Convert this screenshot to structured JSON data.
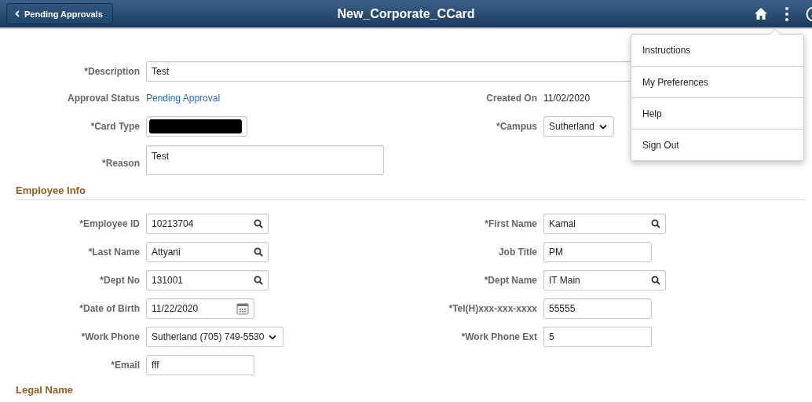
{
  "header": {
    "back_button": "Pending Approvals",
    "title": "New_Corporate_CCard"
  },
  "menu": {
    "items": [
      "Instructions",
      "My Preferences",
      "Help",
      "Sign Out"
    ]
  },
  "top_rows": [
    {
      "left": {
        "label": "*Description",
        "kind": "long_text",
        "value": "Test"
      }
    },
    {
      "left": {
        "label": "Approval Status",
        "kind": "link",
        "value": "Pending Approval"
      },
      "right": {
        "label": "Created On",
        "kind": "static",
        "value": "11/02/2020"
      }
    },
    {
      "left": {
        "label": "*Card Type",
        "kind": "redacted"
      },
      "right": {
        "label": "*Campus",
        "kind": "select",
        "value": "Sutherland"
      }
    },
    {
      "left": {
        "label": "*Reason",
        "kind": "textarea",
        "value": "Test"
      }
    }
  ],
  "sections": [
    {
      "title": "Employee Info",
      "rows": [
        {
          "left": {
            "label": "*Employee ID",
            "kind": "lookup",
            "value": "10213704"
          },
          "right": {
            "label": "*First Name",
            "kind": "lookup",
            "value": "Kamal"
          }
        },
        {
          "left": {
            "label": "*Last Name",
            "kind": "lookup",
            "value": "Attyani"
          },
          "right": {
            "label": "Job Title",
            "kind": "text",
            "value": "PM"
          }
        },
        {
          "left": {
            "label": "*Dept No",
            "kind": "lookup",
            "value": "131001"
          },
          "right": {
            "label": "*Dept Name",
            "kind": "lookup",
            "value": "IT Main"
          }
        },
        {
          "left": {
            "label": "*Date of Birth",
            "kind": "date",
            "value": "11/22/2020"
          },
          "right": {
            "label": "*Tel(H)xxx-xxx-xxxx",
            "kind": "text",
            "value": "55555"
          }
        },
        {
          "left": {
            "label": "*Work Phone",
            "kind": "select",
            "value": "Sutherland (705) 749-5530"
          },
          "right": {
            "label": "*Work Phone Ext",
            "kind": "text",
            "value": "5"
          }
        },
        {
          "left": {
            "label": "*Email",
            "kind": "text",
            "value": "fff"
          }
        }
      ]
    },
    {
      "title": "Legal Name"
    }
  ]
}
